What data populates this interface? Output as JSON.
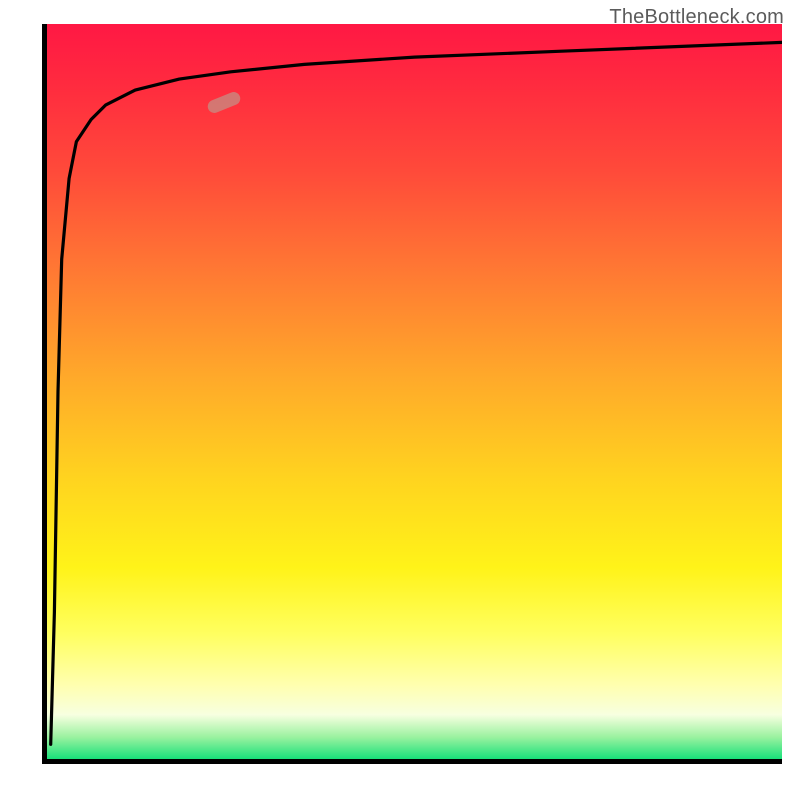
{
  "attribution": "TheBottleneck.com",
  "chart_data": {
    "type": "line",
    "title": "",
    "xlabel": "",
    "ylabel": "",
    "xlim": [
      0,
      100
    ],
    "ylim": [
      0,
      100
    ],
    "grid": false,
    "series": [
      {
        "name": "curve",
        "x": [
          0.5,
          1,
          1.5,
          2,
          3,
          4,
          6,
          8,
          12,
          18,
          25,
          35,
          50,
          70,
          100
        ],
        "y": [
          2,
          20,
          50,
          68,
          79,
          84,
          87,
          89,
          91,
          92.5,
          93.5,
          94.5,
          95.5,
          96.3,
          97.5
        ]
      }
    ],
    "marker": {
      "x": 25,
      "y": 90,
      "label": ""
    },
    "background_gradient": [
      "#ff1844",
      "#ff7a33",
      "#ffd41f",
      "#ffff60",
      "#18e07a"
    ]
  }
}
